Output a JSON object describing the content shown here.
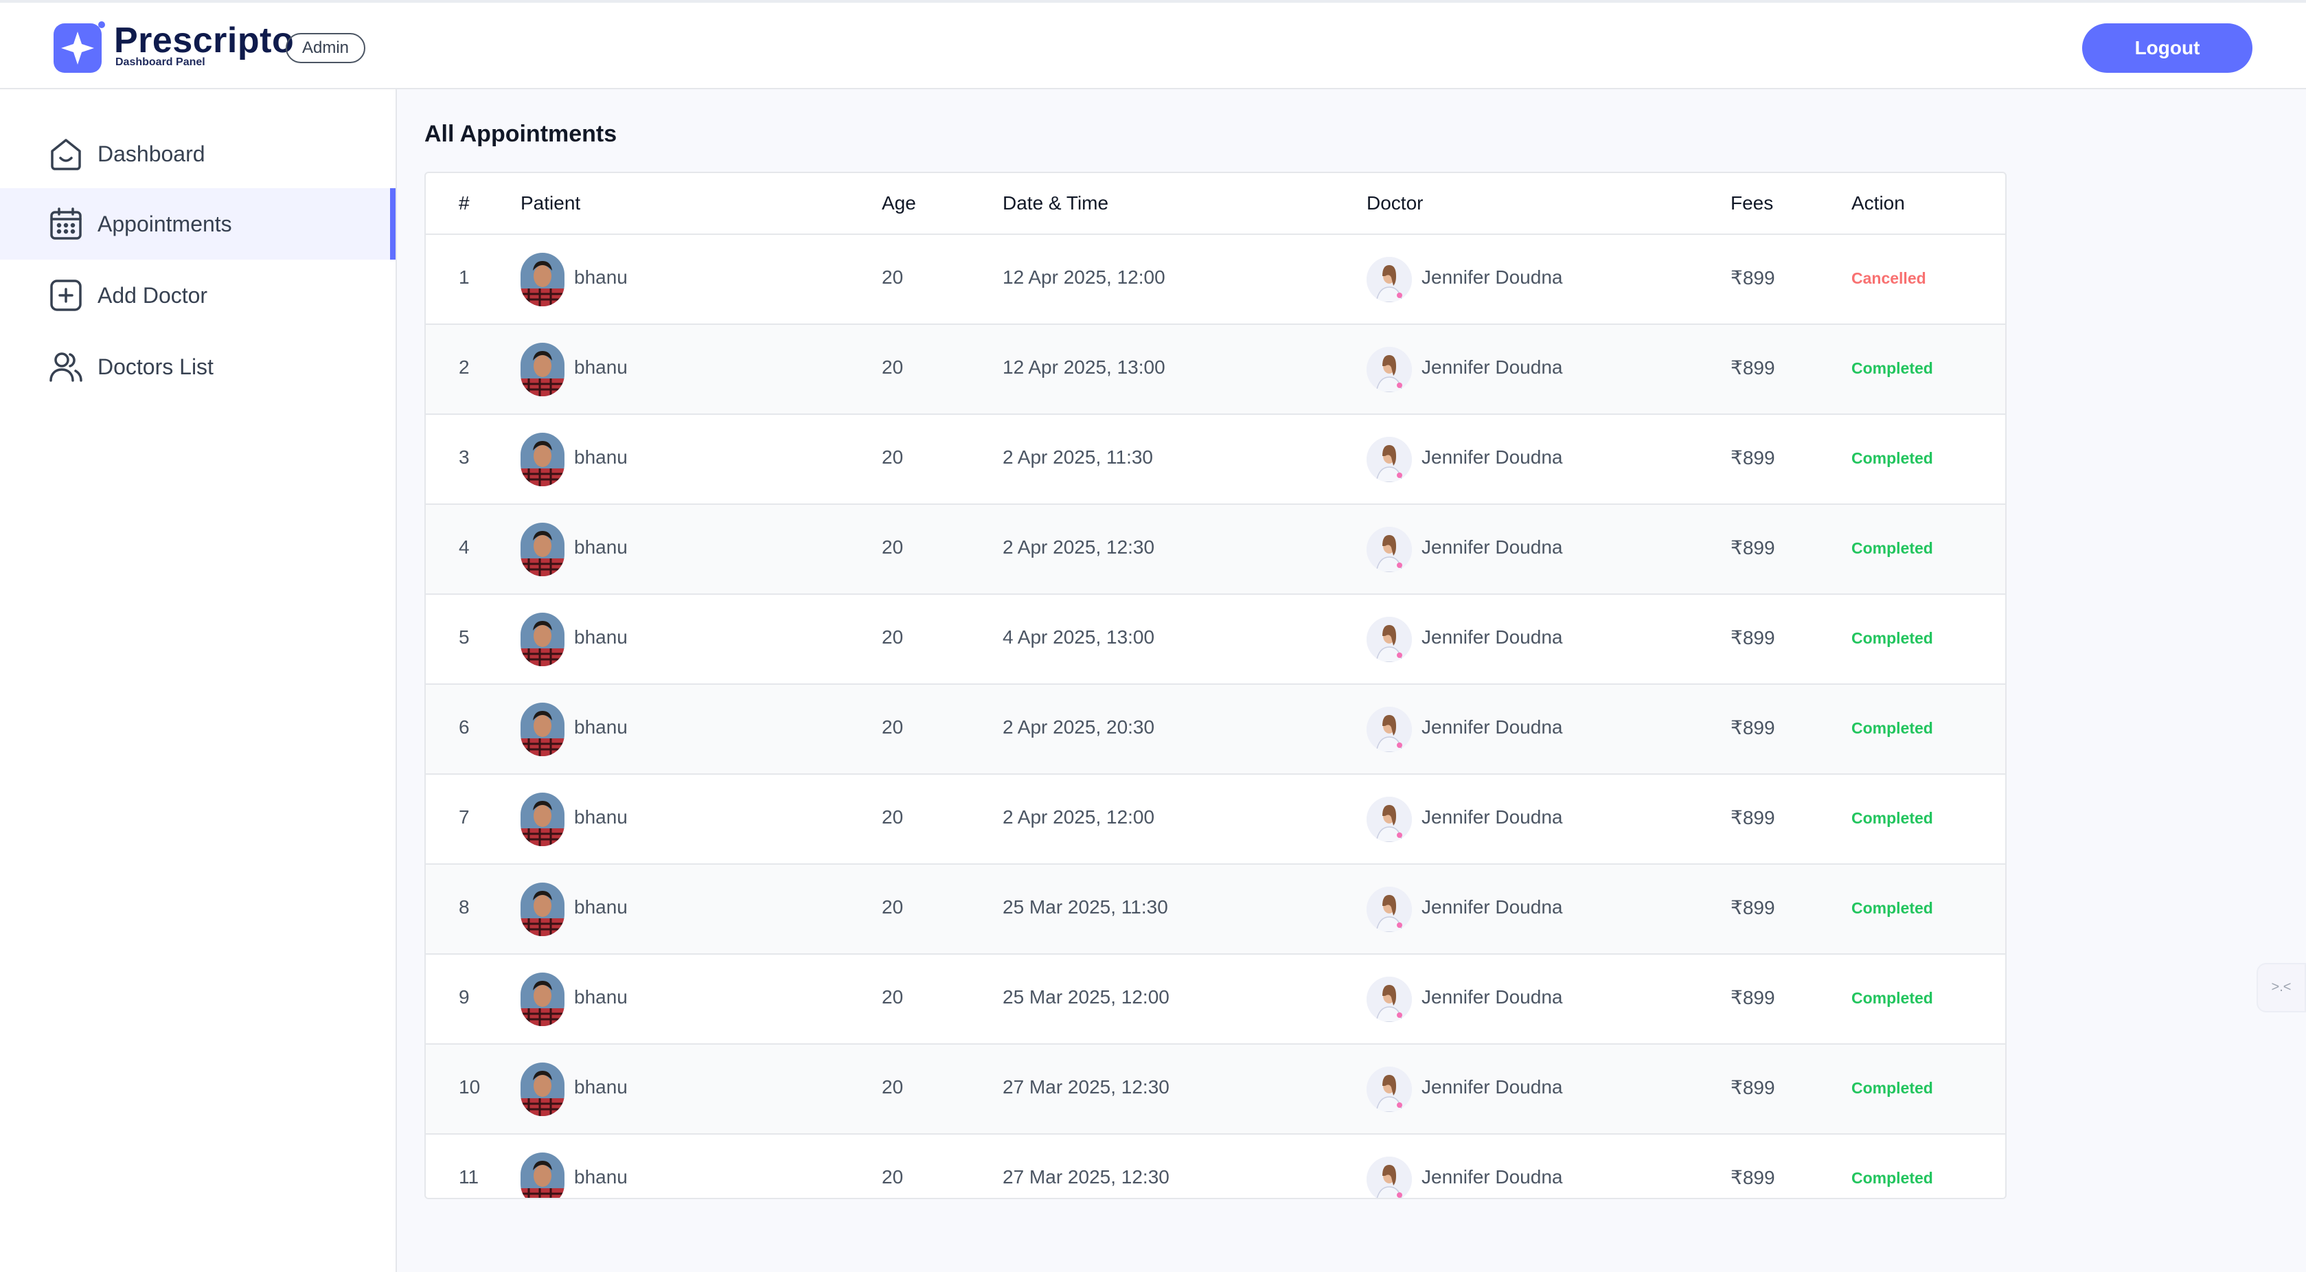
{
  "header": {
    "brand_name": "Prescripto",
    "brand_sub": "Dashboard Panel",
    "role_badge": "Admin",
    "logout_label": "Logout",
    "accent_color": "#5f6fff"
  },
  "sidebar": {
    "items": [
      {
        "label": "Dashboard",
        "icon": "home-icon",
        "active": false
      },
      {
        "label": "Appointments",
        "icon": "calendar-icon",
        "active": true
      },
      {
        "label": "Add Doctor",
        "icon": "add-square-icon",
        "active": false
      },
      {
        "label": "Doctors List",
        "icon": "people-icon",
        "active": false
      }
    ]
  },
  "main": {
    "title": "All Appointments",
    "columns": [
      "#",
      "Patient",
      "Age",
      "Date & Time",
      "Doctor",
      "Fees",
      "Action"
    ],
    "rows": [
      {
        "num": "1",
        "patient": "bhanu",
        "age": "20",
        "datetime": "12 Apr 2025, 12:00",
        "doctor": "Jennifer Doudna",
        "fees": "₹899",
        "status": "Cancelled"
      },
      {
        "num": "2",
        "patient": "bhanu",
        "age": "20",
        "datetime": "12 Apr 2025, 13:00",
        "doctor": "Jennifer Doudna",
        "fees": "₹899",
        "status": "Completed"
      },
      {
        "num": "3",
        "patient": "bhanu",
        "age": "20",
        "datetime": "2 Apr 2025, 11:30",
        "doctor": "Jennifer Doudna",
        "fees": "₹899",
        "status": "Completed"
      },
      {
        "num": "4",
        "patient": "bhanu",
        "age": "20",
        "datetime": "2 Apr 2025, 12:30",
        "doctor": "Jennifer Doudna",
        "fees": "₹899",
        "status": "Completed"
      },
      {
        "num": "5",
        "patient": "bhanu",
        "age": "20",
        "datetime": "4 Apr 2025, 13:00",
        "doctor": "Jennifer Doudna",
        "fees": "₹899",
        "status": "Completed"
      },
      {
        "num": "6",
        "patient": "bhanu",
        "age": "20",
        "datetime": "2 Apr 2025, 20:30",
        "doctor": "Jennifer Doudna",
        "fees": "₹899",
        "status": "Completed"
      },
      {
        "num": "7",
        "patient": "bhanu",
        "age": "20",
        "datetime": "2 Apr 2025, 12:00",
        "doctor": "Jennifer Doudna",
        "fees": "₹899",
        "status": "Completed"
      },
      {
        "num": "8",
        "patient": "bhanu",
        "age": "20",
        "datetime": "25 Mar 2025, 11:30",
        "doctor": "Jennifer Doudna",
        "fees": "₹899",
        "status": "Completed"
      },
      {
        "num": "9",
        "patient": "bhanu",
        "age": "20",
        "datetime": "25 Mar 2025, 12:00",
        "doctor": "Jennifer Doudna",
        "fees": "₹899",
        "status": "Completed"
      },
      {
        "num": "10",
        "patient": "bhanu",
        "age": "20",
        "datetime": "27 Mar 2025, 12:30",
        "doctor": "Jennifer Doudna",
        "fees": "₹899",
        "status": "Completed"
      },
      {
        "num": "11",
        "patient": "bhanu",
        "age": "20",
        "datetime": "27 Mar 2025, 12:30",
        "doctor": "Jennifer Doudna",
        "fees": "₹899",
        "status": "Completed"
      }
    ]
  },
  "widget": {
    "label": ">.<",
    "icon": "assistant-widget-icon"
  },
  "colors": {
    "cancelled": "#f87171",
    "completed": "#22c55e"
  }
}
